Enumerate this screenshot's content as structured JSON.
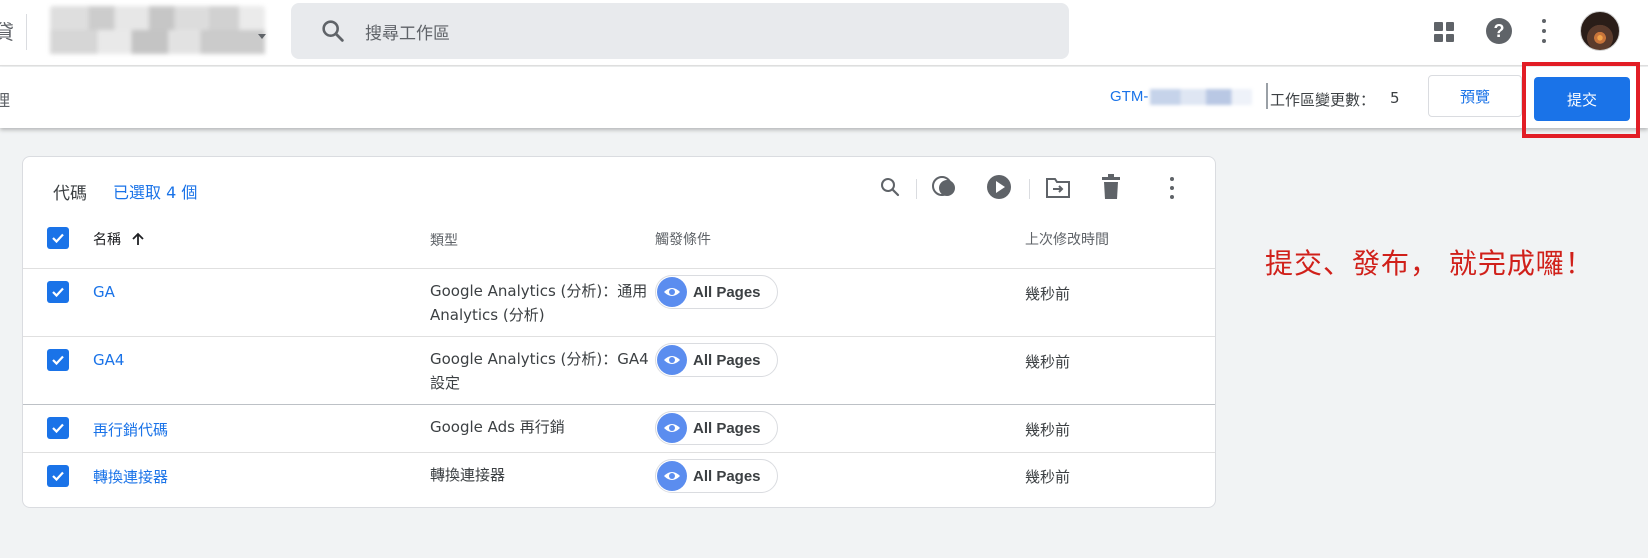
{
  "top_bar": {
    "clipped_text": "貸",
    "search_placeholder": "搜尋工作區"
  },
  "sub_bar": {
    "clipped_text": "理",
    "container_id_prefix": "GTM-",
    "changes_label": "工作區變更數：",
    "changes_count": "5",
    "preview_label": "預覽",
    "submit_label": "提交"
  },
  "card": {
    "title": "代碼",
    "selected_text": "已選取 4 個",
    "columns": {
      "name": "名稱",
      "type": "類型",
      "trigger": "觸發條件",
      "modified": "上次修改時間"
    },
    "rows": [
      {
        "name": "GA",
        "type": "Google Analytics (分析)：通用 Analytics (分析)",
        "trigger": "All Pages",
        "modified": "幾秒前"
      },
      {
        "name": "GA4",
        "type": "Google Analytics (分析)：GA4 設定",
        "trigger": "All Pages",
        "modified": "幾秒前"
      },
      {
        "name": "再行銷代碼",
        "type": "Google Ads 再行銷",
        "trigger": "All Pages",
        "modified": "幾秒前"
      },
      {
        "name": "轉換連接器",
        "type": "轉換連接器",
        "trigger": "All Pages",
        "modified": "幾秒前"
      }
    ]
  },
  "annotation": "提交、發布， 就完成囉！",
  "colors": {
    "accent": "#1a73e8",
    "highlight": "#e21d25",
    "annotation": "#d0201a"
  },
  "icons": [
    "search-icon",
    "apps-icon",
    "help-icon",
    "more-vert-icon",
    "avatar",
    "compare-icon",
    "play-icon",
    "move-to-folder-icon",
    "delete-icon",
    "eye-icon",
    "checkbox-checked-icon",
    "sort-arrow-up-icon"
  ]
}
